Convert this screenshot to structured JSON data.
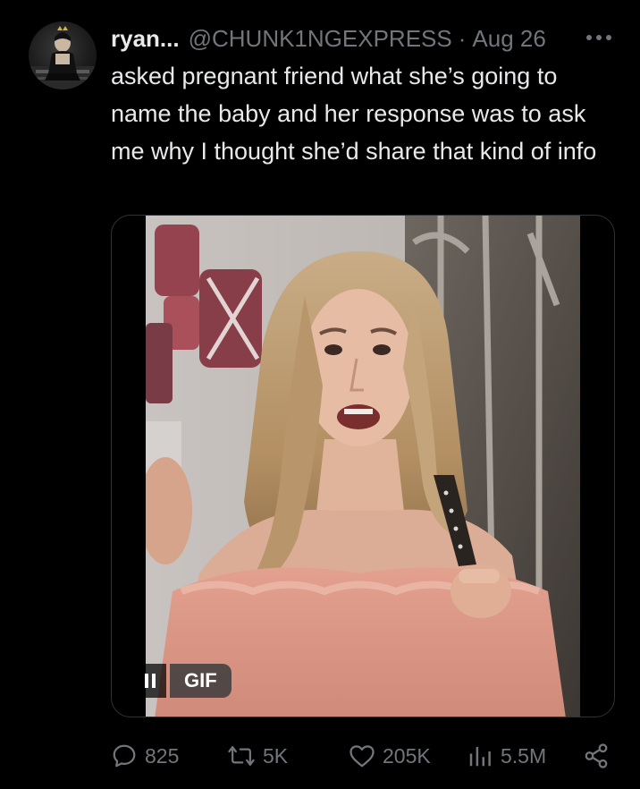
{
  "tweet": {
    "display_name": "ryan...",
    "handle": "@CHUNK1NGEXPRESS",
    "separator": "·",
    "date": "Aug 26",
    "text": "asked pregnant friend what she’s going to name the baby and her response was to ask me why I thought she’d share that kind of info"
  },
  "media": {
    "badge_label": "GIF",
    "pause_icon": "pause-icon"
  },
  "actions": {
    "replies": "825",
    "reposts": "5K",
    "likes": "205K",
    "views": "5.5M"
  },
  "icons": {
    "more": "more-dots-icon",
    "reply": "reply-bubble-icon",
    "repost": "repost-arrows-icon",
    "like": "heart-icon",
    "views": "bar-chart-icon",
    "share": "share-icon"
  },
  "colors": {
    "background": "#000000",
    "text": "#e7e9ea",
    "muted": "#71767b",
    "border": "#2f3336"
  }
}
